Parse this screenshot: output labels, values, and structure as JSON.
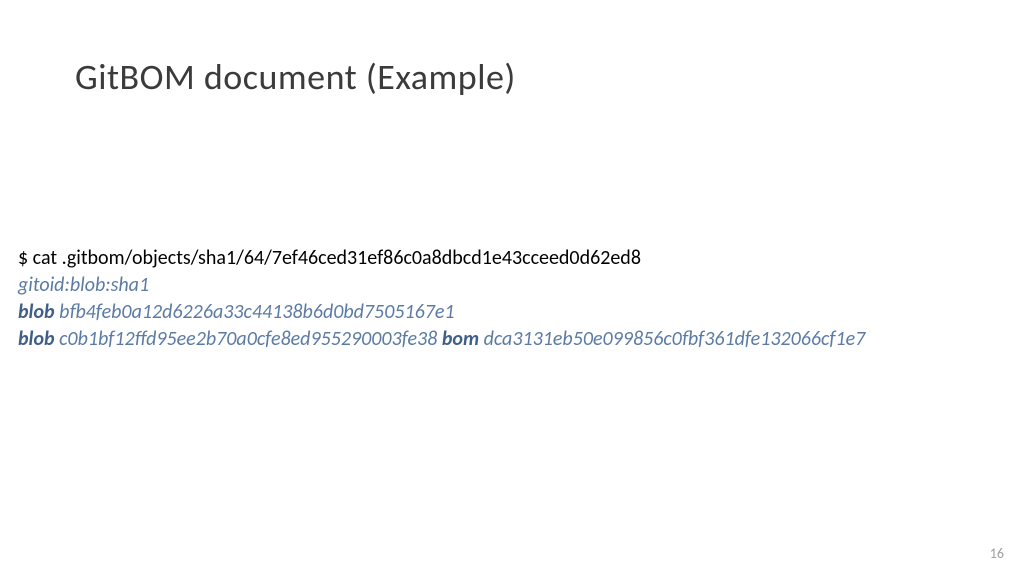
{
  "title": "GitBOM document (Example)",
  "command": "$ cat .gitbom/objects/sha1/64/7ef46ced31ef86c0a8dbcd1e43cceed0d62ed8",
  "gitoid_line": "gitoid:blob:sha1",
  "line2": {
    "kw": "blob",
    "hash": "bfb4feb0a12d6226a33c44138b6d0bd7505167e1"
  },
  "line3": {
    "kw1": "blob",
    "hash1": "c0b1bf12ffd95ee2b70a0cfe8ed955290003fe38",
    "kw2": "bom",
    "hash2": "dca3131eb50e099856c0fbf361dfe132066cf1e7"
  },
  "page_number": "16"
}
